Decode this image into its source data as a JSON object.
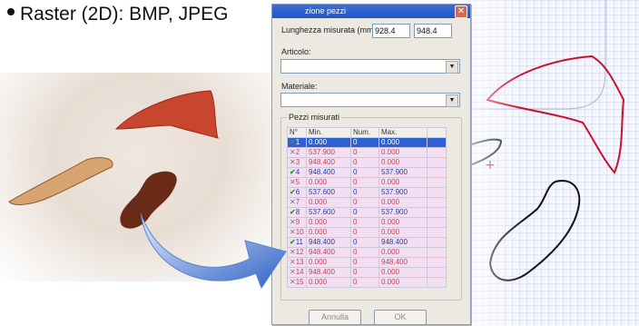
{
  "slide": {
    "bullet": "Raster (2D): BMP, JPEG"
  },
  "dialog": {
    "title": "zione pezzi",
    "close_glyph": "✕",
    "length_label": "Lunghezza misurata (mm):",
    "length_value1": "928.4",
    "length_value2": "948.4",
    "articolo_label": "Articolo:",
    "materiale_label": "Materiale:",
    "group_title": "Pezzi misurati",
    "columns": [
      "N°",
      "Min.",
      "Num.",
      "Max."
    ],
    "rows": [
      {
        "state": "x",
        "n": "1",
        "min": "0.000",
        "num": "0",
        "max": "0.000",
        "sel": true
      },
      {
        "state": "x",
        "n": "2",
        "min": "537.900",
        "num": "0",
        "max": "0.000"
      },
      {
        "state": "x",
        "n": "3",
        "min": "948.400",
        "num": "0",
        "max": "0.000"
      },
      {
        "state": "ok",
        "n": "4",
        "min": "948.400",
        "num": "0",
        "max": "537.900"
      },
      {
        "state": "x",
        "n": "5",
        "min": "0.000",
        "num": "0",
        "max": "0.000"
      },
      {
        "state": "ok",
        "n": "6",
        "min": "537.600",
        "num": "0",
        "max": "537.900"
      },
      {
        "state": "x",
        "n": "7",
        "min": "0.000",
        "num": "0",
        "max": "0.000"
      },
      {
        "state": "ok",
        "n": "8",
        "min": "537.600",
        "num": "0",
        "max": "537.900"
      },
      {
        "state": "x",
        "n": "9",
        "min": "0.000",
        "num": "0",
        "max": "0.000"
      },
      {
        "state": "x",
        "n": "10",
        "min": "0.000",
        "num": "0",
        "max": "0.000"
      },
      {
        "state": "ok",
        "n": "11",
        "min": "948.400",
        "num": "0",
        "max": "948.400"
      },
      {
        "state": "x",
        "n": "12",
        "min": "948.400",
        "num": "0",
        "max": "0.000"
      },
      {
        "state": "x",
        "n": "13",
        "min": "0.000",
        "num": "0",
        "max": "948.400"
      },
      {
        "state": "x",
        "n": "14",
        "min": "948.400",
        "num": "0",
        "max": "0.000"
      },
      {
        "state": "x",
        "n": "15",
        "min": "0.000",
        "num": "0",
        "max": "0.000"
      }
    ],
    "cancel_label": "Annulla",
    "ok_label": "OK"
  },
  "icons": {
    "x_mark": "✕",
    "check_mark": "✔",
    "dropdown": "▼"
  },
  "colors": {
    "titlebar": "#2256c8",
    "selection": "#2e5fd3",
    "row_bg": "#f4def2",
    "shape_red": "#c8102e"
  }
}
